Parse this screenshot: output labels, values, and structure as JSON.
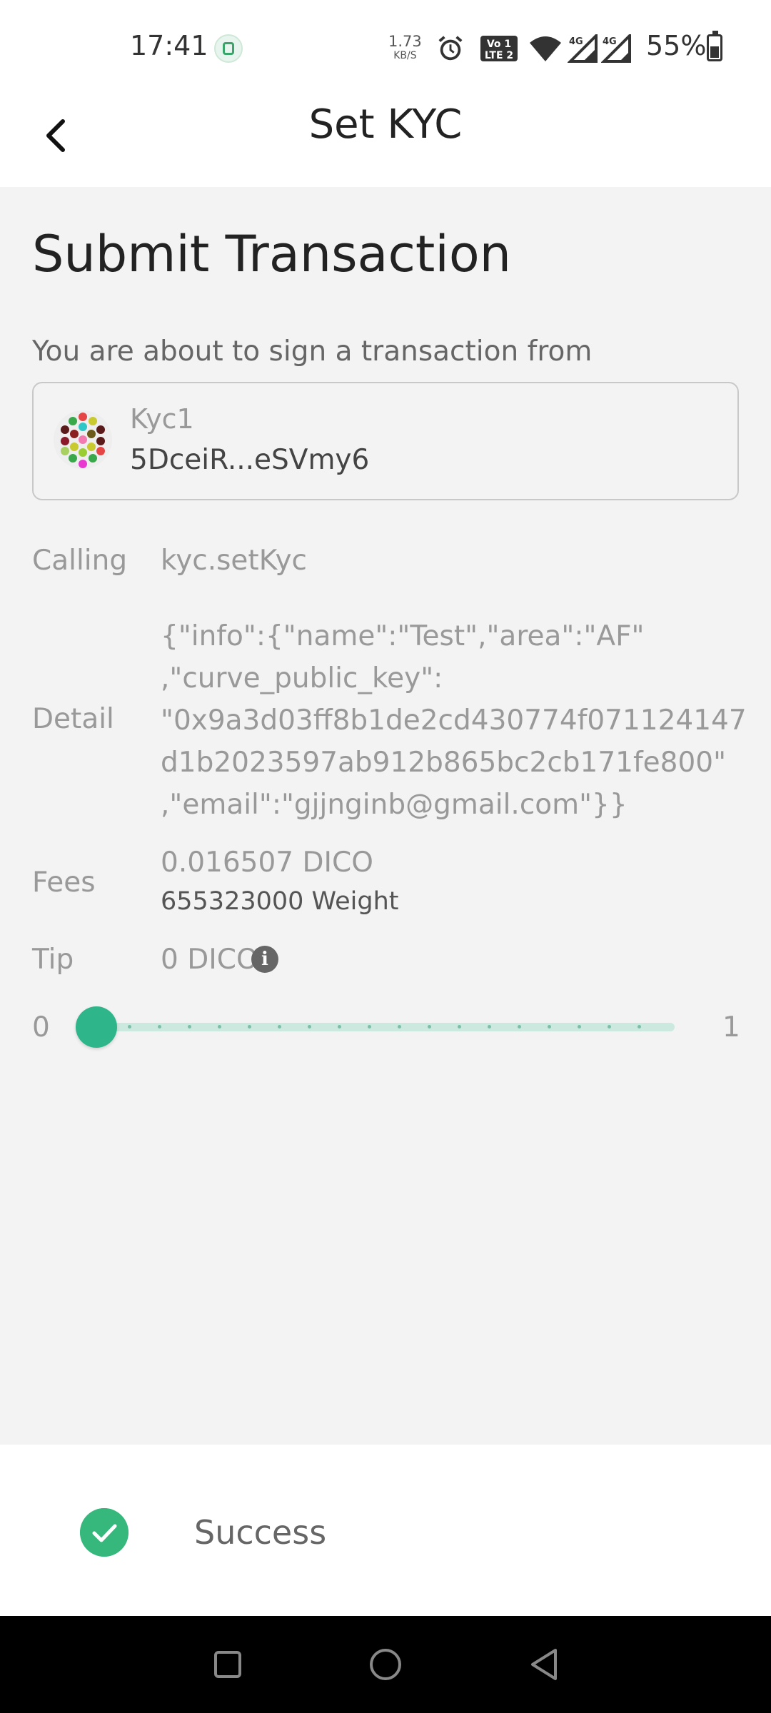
{
  "status_bar": {
    "time": "17:41",
    "net_speed_value": "1.73",
    "net_speed_unit": "KB/S",
    "volte_label": "Vo LTE 2",
    "signal_1_label": "4G",
    "signal_2_label": "4G",
    "battery_text": "55%",
    "icons": [
      "app-notification-icon",
      "alarm-icon",
      "volte-icon",
      "wifi-icon",
      "signal-4g-icon",
      "signal-4g-icon",
      "battery-icon"
    ]
  },
  "app_bar": {
    "title": "Set KYC",
    "back_icon": "chevron-left-icon"
  },
  "transaction": {
    "page_title": "Submit Transaction",
    "intro": "You are about to sign a transaction from",
    "account": {
      "name": "Kyc1",
      "address": "5DceiR...eSVmy6",
      "avatar_icon": "identicon"
    },
    "calling_label": "Calling",
    "calling_value": "kyc.setKyc",
    "detail_label": "Detail",
    "detail_value": "{\"info\":{\"name\":\"Test\",\"area\":\"AF\"\n,\"curve_public_key\":\n\"0x9a3d03ff8b1de2cd430774f071124147\nd1b2023597ab912b865bc2cb171fe800\"\n,\"email\":\"gjjnginb@gmail.com\"}}",
    "fees_label": "Fees",
    "fees_amount": "0.016507 DICO",
    "fees_weight": "655323000 Weight",
    "tip_label": "Tip",
    "tip_value": "0 DICO",
    "tip_info_icon": "info-icon"
  },
  "tip_slider": {
    "min_label": "0",
    "max_label": "1",
    "value_fraction": 0.0,
    "color": "#2eb58a",
    "track_color": "#cce9df"
  },
  "result": {
    "status_text": "Success",
    "status_icon": "check-circle-icon",
    "status_color": "#36b77b"
  },
  "nav_bar": {
    "buttons": [
      "recent-apps-button",
      "home-button",
      "back-button"
    ]
  }
}
